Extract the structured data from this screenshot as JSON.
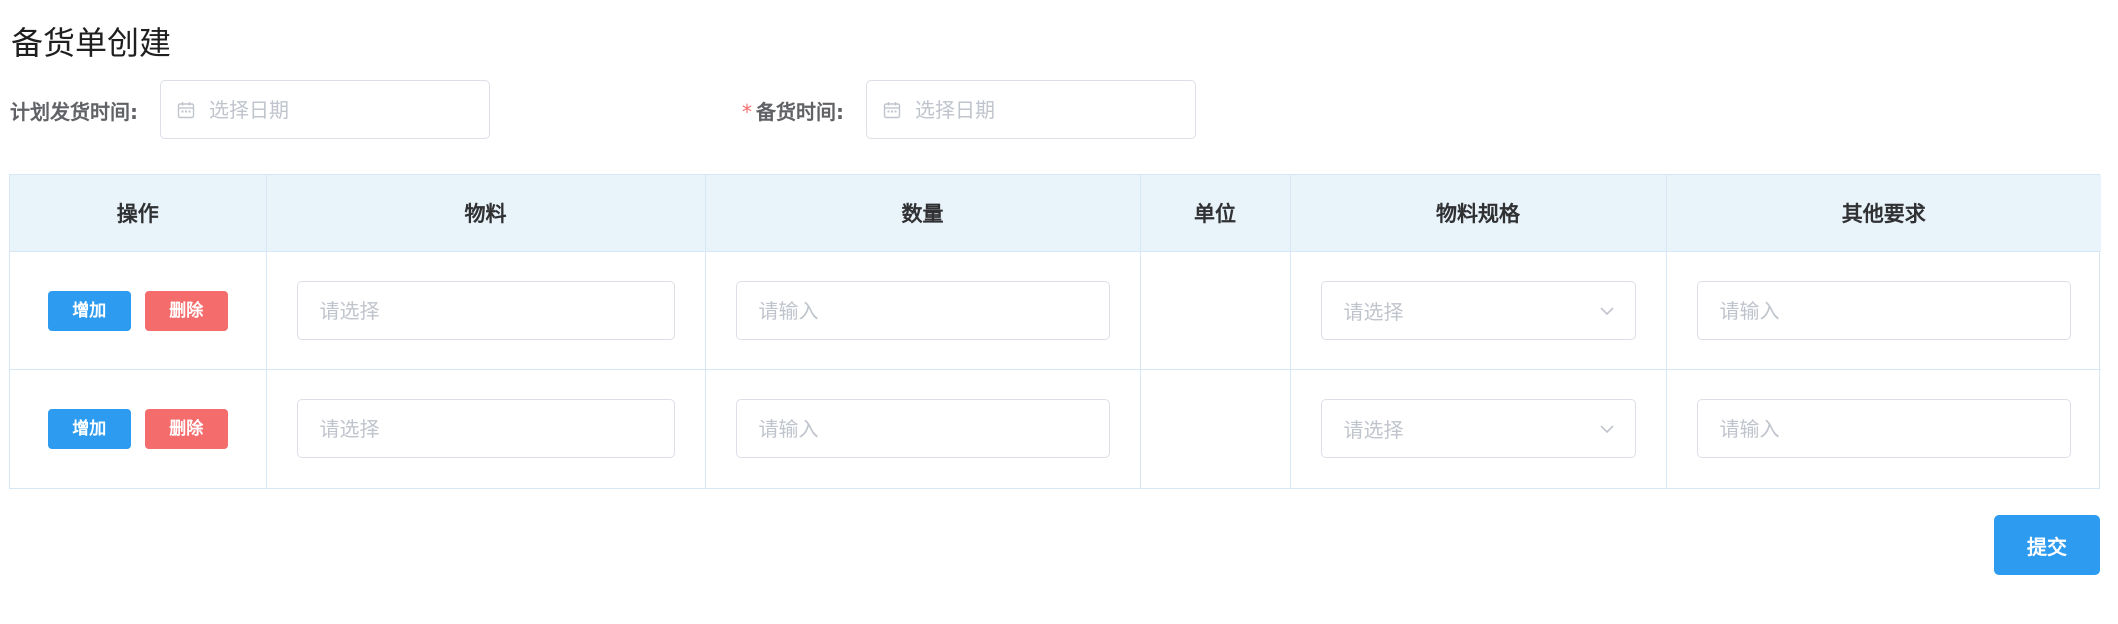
{
  "page": {
    "title": "备货单创建"
  },
  "filters": {
    "plan_date": {
      "label": "计划发货时间:",
      "placeholder": "选择日期",
      "value": ""
    },
    "stock_date": {
      "label": "备货时间:",
      "required_mark": "*",
      "placeholder": "选择日期",
      "value": ""
    }
  },
  "table": {
    "columns": [
      "操作",
      "物料",
      "数量",
      "单位",
      "物料规格",
      "其他要求"
    ],
    "rows": [
      {
        "add_label": "增加",
        "delete_label": "删除",
        "material_placeholder": "请选择",
        "quantity_placeholder": "请输入",
        "unit": "",
        "spec_placeholder": "请选择",
        "other_placeholder": "请输入"
      },
      {
        "add_label": "增加",
        "delete_label": "删除",
        "material_placeholder": "请选择",
        "quantity_placeholder": "请输入",
        "unit": "",
        "spec_placeholder": "请选择",
        "other_placeholder": "请输入"
      }
    ]
  },
  "actions": {
    "submit_label": "提交"
  },
  "icons": {
    "date": "calendar-icon",
    "select": "chevron-down-icon"
  },
  "colors": {
    "primary": "#2d9bef",
    "danger": "#f56c6c",
    "header_bg": "#e9f3fa",
    "required": "#f56c6c"
  }
}
